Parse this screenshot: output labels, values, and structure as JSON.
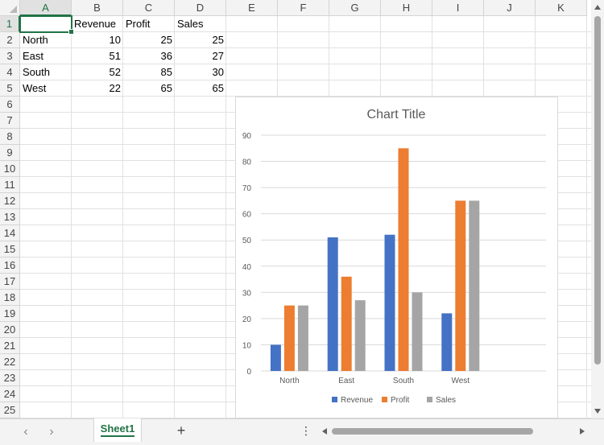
{
  "columns": [
    "A",
    "B",
    "C",
    "D",
    "E",
    "F",
    "G",
    "H",
    "I",
    "J",
    "K"
  ],
  "rows": [
    "1",
    "2",
    "3",
    "4",
    "5",
    "6",
    "7",
    "8",
    "9",
    "10",
    "11",
    "12",
    "13",
    "14",
    "15",
    "16",
    "17",
    "18",
    "19",
    "20",
    "21",
    "22",
    "23",
    "24",
    "25"
  ],
  "selected_column": "A",
  "selected_row": "1",
  "sheet": {
    "headers": [
      "",
      "Revenue",
      "Profit",
      "Sales"
    ],
    "data": [
      [
        "North",
        "10",
        "25",
        "25"
      ],
      [
        "East",
        "51",
        "36",
        "27"
      ],
      [
        "South",
        "52",
        "85",
        "30"
      ],
      [
        "West",
        "22",
        "65",
        "65"
      ]
    ]
  },
  "chart_data": {
    "type": "bar",
    "title": "Chart Title",
    "categories": [
      "North",
      "East",
      "South",
      "West"
    ],
    "series": [
      {
        "name": "Revenue",
        "values": [
          10,
          51,
          52,
          22
        ],
        "color": "#4472C4"
      },
      {
        "name": "Profit",
        "values": [
          25,
          36,
          85,
          65
        ],
        "color": "#ED7D31"
      },
      {
        "name": "Sales",
        "values": [
          25,
          27,
          30,
          65
        ],
        "color": "#A5A5A5"
      }
    ],
    "yticks": [
      "0",
      "10",
      "20",
      "30",
      "40",
      "50",
      "60",
      "70",
      "80",
      "90"
    ],
    "ylim": [
      0,
      90
    ],
    "grid": true,
    "legend": "bottom"
  },
  "tabs": {
    "sheet_tab": "Sheet1",
    "prev_icon": "chevron-left-icon",
    "next_icon": "chevron-right-icon",
    "add_icon": "plus-icon",
    "more_icon": "vertical-dots-icon"
  }
}
